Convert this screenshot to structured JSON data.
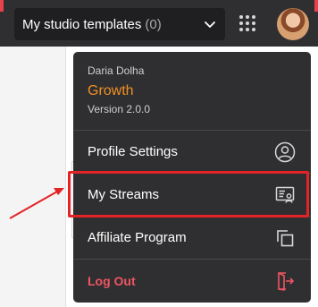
{
  "header": {
    "templates_label": "My studio templates",
    "templates_count": "(0)",
    "apps_icon": "grid-dots-icon",
    "avatar_icon": "user-avatar"
  },
  "menu": {
    "user_name": "Daria Dolha",
    "plan": "Growth",
    "version": "Version 2.0.0",
    "items": [
      {
        "label": "Profile Settings",
        "icon": "user-circle-icon"
      },
      {
        "label": "My Streams",
        "icon": "streams-icon"
      },
      {
        "label": "Affiliate Program",
        "icon": "copy-icon"
      },
      {
        "label": "Log Out",
        "icon": "logout-icon"
      }
    ]
  },
  "colors": {
    "topbar": "#2f2f31",
    "plan": "#f28f24",
    "logout": "#ef5561",
    "highlight": "#e32325"
  }
}
